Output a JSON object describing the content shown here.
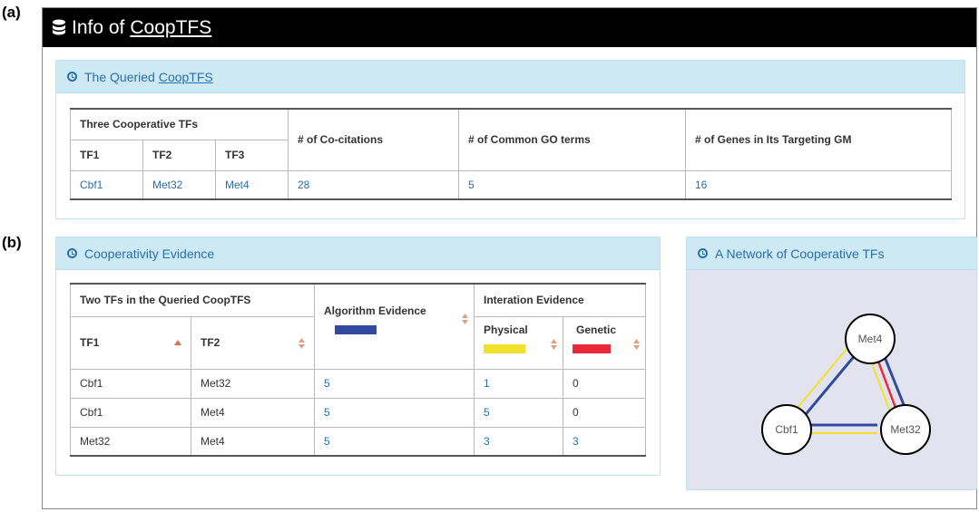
{
  "figure_labels": {
    "a": "(a)",
    "b": "(b)"
  },
  "titlebar": {
    "prefix": "Info of",
    "link": "CoopTFS"
  },
  "panel_a": {
    "title_prefix": "The Queried",
    "title_link": "CoopTFS",
    "table": {
      "group_header": "Three Cooperative TFs",
      "sub_headers": [
        "TF1",
        "TF2",
        "TF3"
      ],
      "col_cocitations": "# of Co-citations",
      "col_go_terms": "# of Common GO terms",
      "col_genes": "# of Genes in Its Targeting GM",
      "row": {
        "tf1": "Cbf1",
        "tf2": "Met32",
        "tf3": "Met4",
        "cocitations": "28",
        "go_terms": "5",
        "genes": "16"
      }
    }
  },
  "panel_b": {
    "title": "Cooperativity Evidence",
    "table": {
      "group_tfs": "Two TFs in the Queried CoopTFS",
      "col_tf1": "TF1",
      "col_tf2": "TF2",
      "col_algorithm": "Algorithm Evidence",
      "group_interaction": "Interation Evidence",
      "col_physical": "Physical",
      "col_genetic": "Genetic",
      "rows": [
        {
          "tf1": "Cbf1",
          "tf2": "Met32",
          "algorithm": "5",
          "physical": "1",
          "genetic": "0"
        },
        {
          "tf1": "Cbf1",
          "tf2": "Met4",
          "algorithm": "5",
          "physical": "5",
          "genetic": "0"
        },
        {
          "tf1": "Met32",
          "tf2": "Met4",
          "algorithm": "5",
          "physical": "3",
          "genetic": "3"
        }
      ]
    },
    "colors": {
      "algorithm": "#2f4a9e",
      "physical": "#f0e22a",
      "genetic": "#e8293a"
    }
  },
  "panel_c": {
    "title": "A Network of Cooperative TFs",
    "nodes": [
      "Met4",
      "Cbf1",
      "Met32"
    ]
  },
  "colors": {
    "titlebar_bg": "#000000",
    "panel_header_bg": "#cde9f4",
    "link": "#2a6fa8",
    "sort_arrow": "#e0704a"
  }
}
